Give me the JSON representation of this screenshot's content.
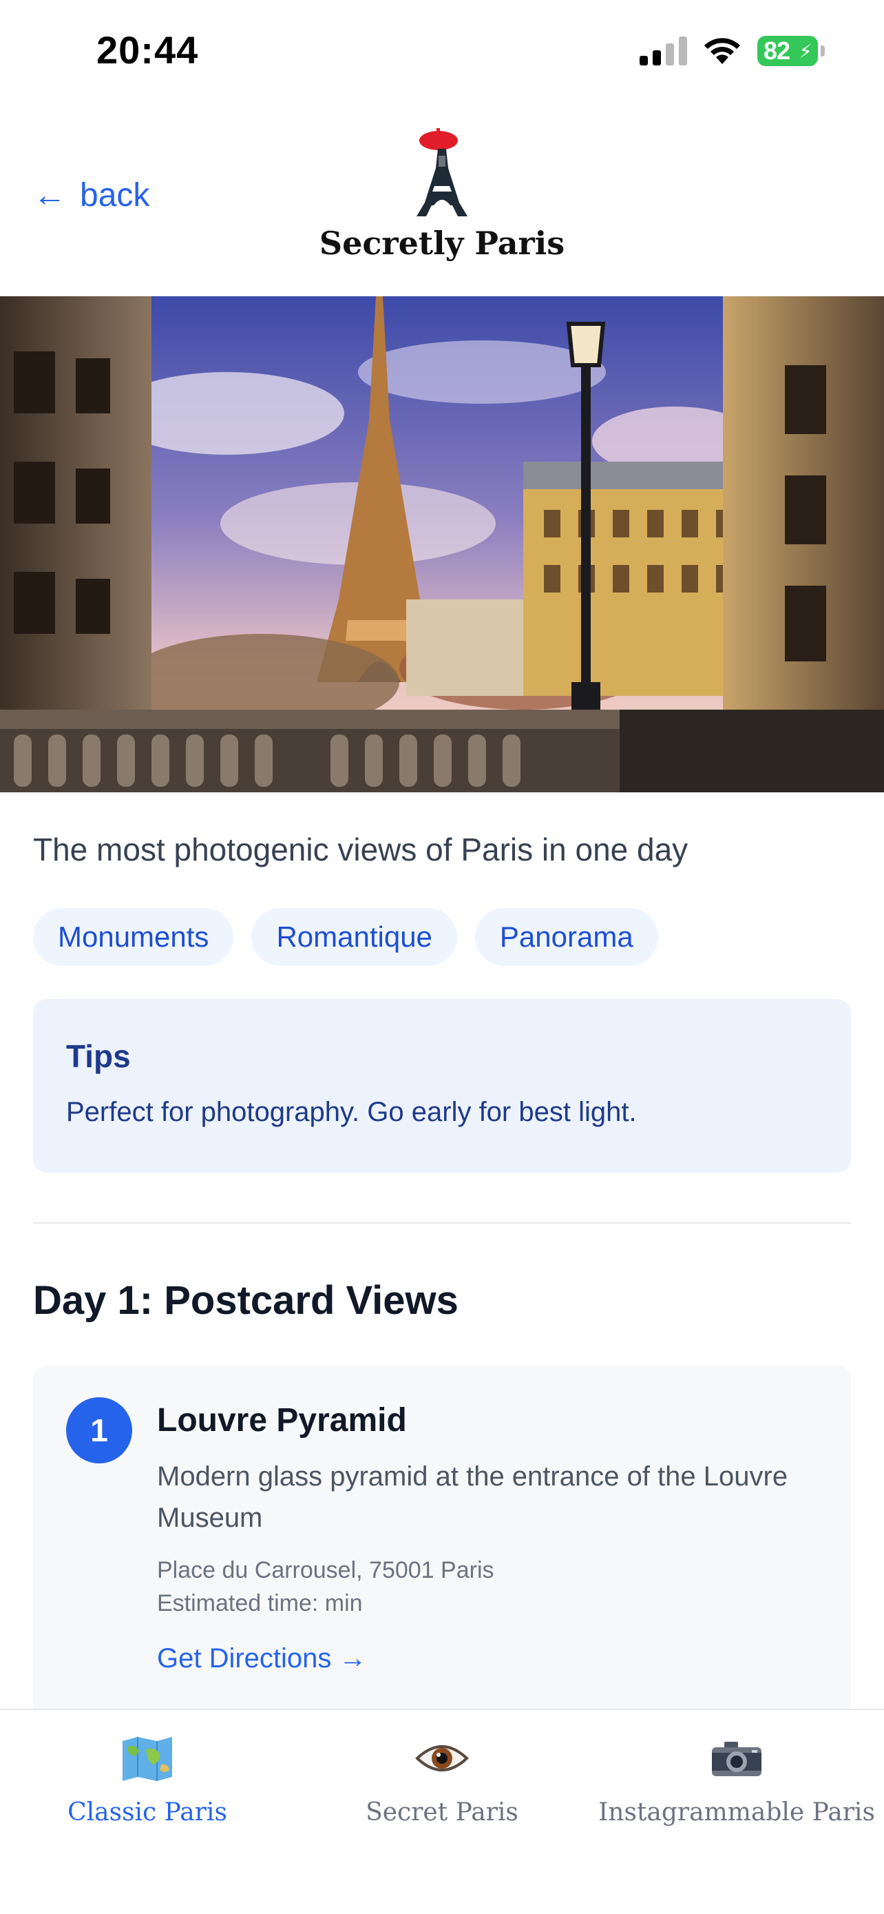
{
  "status_bar": {
    "time": "20:44",
    "battery": "82",
    "icons": [
      "signal-icon",
      "wifi-icon",
      "battery-icon"
    ]
  },
  "header": {
    "back_label": "back",
    "back_icon": "arrow-left-icon",
    "logo_text": "Secretly Paris",
    "logo_icon": "eiffel-tower-beret-icon"
  },
  "hero": {
    "description": "photo"
  },
  "subtitle": "The most photogenic views of Paris in one day",
  "tags": [
    "Monuments",
    "Romantique",
    "Panorama"
  ],
  "tips": {
    "title": "Tips",
    "text": "Perfect for photography. Go early for best light."
  },
  "day": {
    "title": "Day 1: Postcard Views",
    "stops": [
      {
        "number": "1",
        "name": "Louvre Pyramid",
        "description": "Modern glass pyramid at the entrance of the Louvre Museum",
        "address": "Place du Carrousel, 75001 Paris",
        "time": "Estimated time: min",
        "directions_label": "Get Directions →"
      }
    ]
  },
  "tab_bar": {
    "tabs": [
      {
        "label": "Classic Paris",
        "icon": "world-map-icon",
        "active": true
      },
      {
        "label": "Secret Paris",
        "icon": "eye-icon",
        "active": false
      },
      {
        "label": "Instagrammable Paris",
        "icon": "camera-icon",
        "active": false
      }
    ]
  },
  "colors": {
    "accent": "#2563eb",
    "tag_bg": "#eff5ff",
    "tips_bg": "#edf3fd",
    "tips_text": "#1e3a8a",
    "beret": "#e11d2a"
  }
}
